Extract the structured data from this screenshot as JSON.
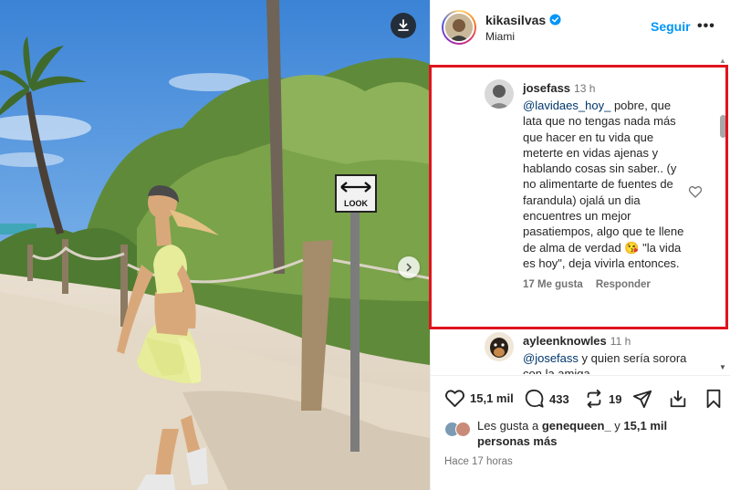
{
  "post": {
    "username": "kikasilvas",
    "location": "Miami",
    "follow_label": "Seguir",
    "more_label": "•••",
    "verified_color": "#0095f6"
  },
  "photo": {
    "sign_text": "LOOK"
  },
  "comments": [
    {
      "username": "josefass",
      "time": "13 h",
      "mention": "@lavidaes_hoy_",
      "text": " pobre, que lata que no tengas nada más que hacer en tu vida que meterte en vidas ajenas y hablando cosas sin saber.. (y no alimentarte de fuentes de farandula) ojalá un dia encuentres un mejor pasatiempos, algo que te llene de alma de verdad 😘 \"la vida es hoy\", deja vivirla entonces.",
      "likes": "17 Me gusta",
      "reply": "Responder"
    },
    {
      "username": "ayleenknowles",
      "time": "11 h",
      "mention": "@josefass",
      "text": " y quien sería sorora con la amiga"
    }
  ],
  "actions": {
    "likes_count": "15,1 mil",
    "comments_count": "433",
    "reposts_count": "19"
  },
  "likes": {
    "prefix": "Les gusta a ",
    "first_user": "genequeen_",
    "middle": " y ",
    "others": "15,1 mil",
    "suffix": "personas más"
  },
  "time_ago": "Hace 17 horas",
  "colors": {
    "accent": "#0095f6",
    "highlight": "#e0141e",
    "mention": "#00376b",
    "secondary_text": "#737373"
  },
  "icons": [
    "download-icon",
    "chevron-right-icon",
    "verified-icon",
    "heart-icon",
    "comment-icon",
    "repost-icon",
    "share-icon",
    "save-icon"
  ]
}
